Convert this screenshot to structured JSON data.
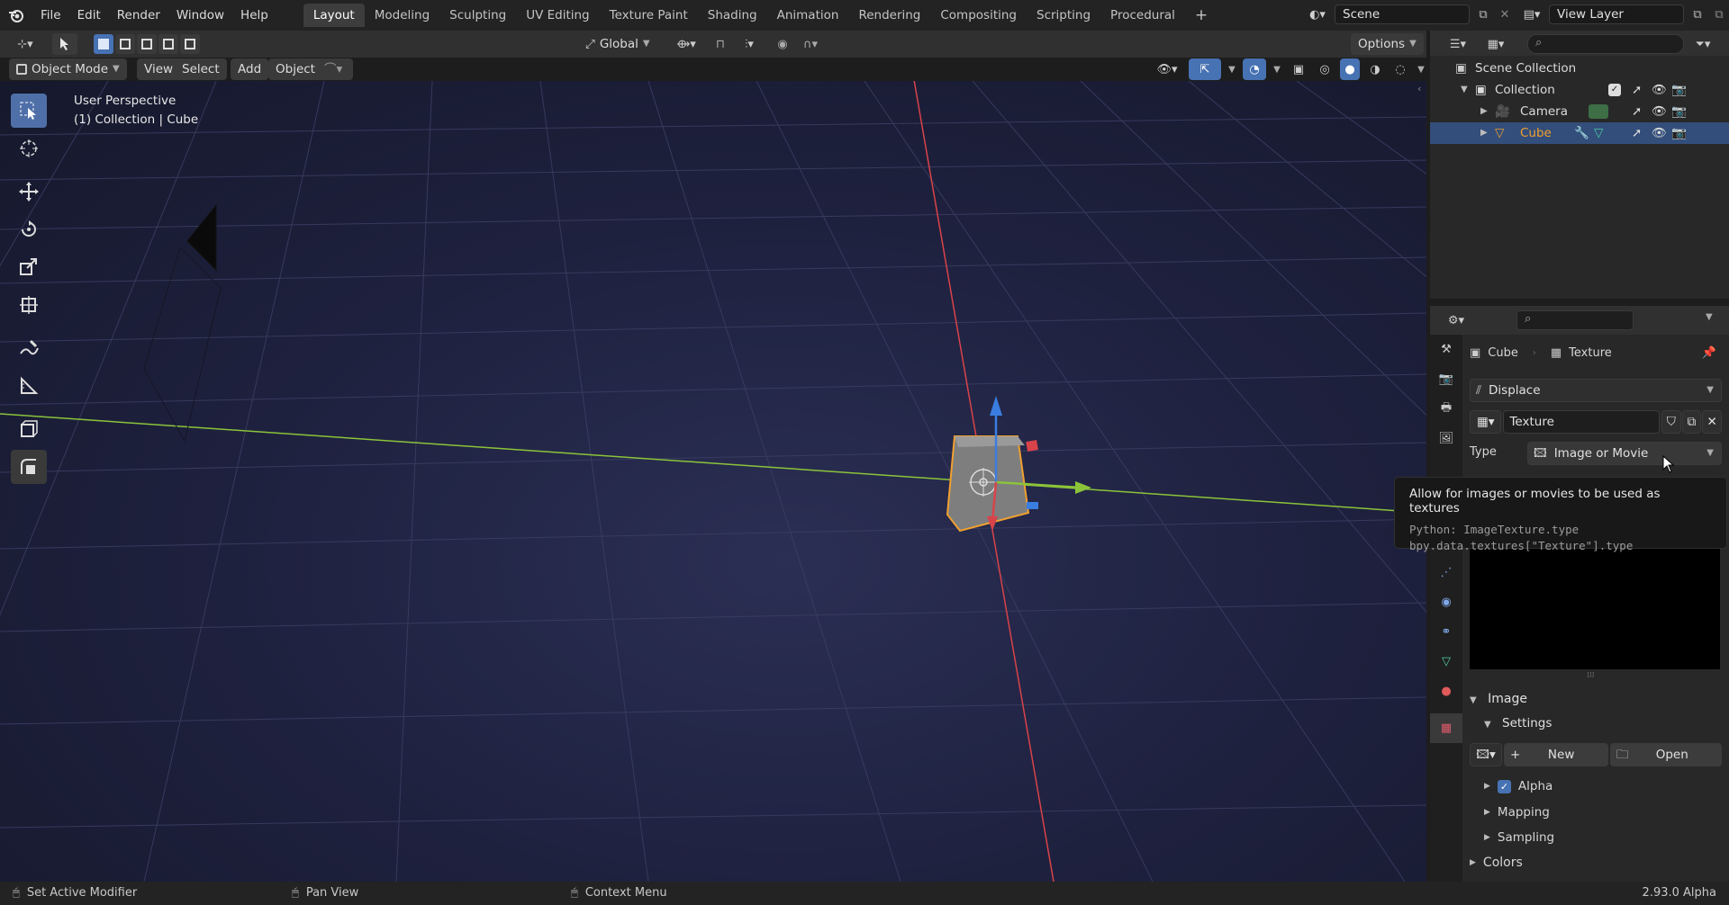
{
  "topbar": {
    "menus": [
      "File",
      "Edit",
      "Render",
      "Window",
      "Help"
    ],
    "workspaces": [
      "Layout",
      "Modeling",
      "Sculpting",
      "UV Editing",
      "Texture Paint",
      "Shading",
      "Animation",
      "Rendering",
      "Compositing",
      "Scripting",
      "Procedural"
    ],
    "active_workspace": "Layout",
    "scene": "Scene",
    "view_layer": "View Layer"
  },
  "viewport_header": {
    "transform_orientation": "Global",
    "options_label": "Options",
    "mode": "Object Mode",
    "menus": [
      "View",
      "Select",
      "Add",
      "Object"
    ]
  },
  "viewport": {
    "perspective": "User Perspective",
    "context": "(1) Collection | Cube"
  },
  "outliner": {
    "scene_collection": "Scene Collection",
    "collection": "Collection",
    "camera": "Camera",
    "cube": "Cube"
  },
  "properties": {
    "breadcrumb_object": "Cube",
    "breadcrumb_texture": "Texture",
    "modifier": "Displace",
    "texture_name": "Texture",
    "type_label": "Type",
    "type_value": "Image or Movie",
    "panel_image": "Image",
    "panel_settings": "Settings",
    "new_label": "New",
    "open_label": "Open",
    "alpha_label": "Alpha",
    "alpha_checked": true,
    "mapping_label": "Mapping",
    "sampling_label": "Sampling",
    "colors_label": "Colors"
  },
  "tooltip": {
    "description": "Allow for images or movies to be used as textures",
    "python_line1": "Python: ImageTexture.type",
    "python_line2": "bpy.data.textures[\"Texture\"].type"
  },
  "statusbar": {
    "left": "Set Active Modifier",
    "middle": "Pan View",
    "right": "Context Menu",
    "version": "2.93.0 Alpha"
  },
  "colors": {
    "accent_blue": "#4772b3",
    "selection": "#334e7a",
    "cube_orange": "#f0a030",
    "x_axis": "#d9434a",
    "y_axis": "#8bc43a"
  }
}
